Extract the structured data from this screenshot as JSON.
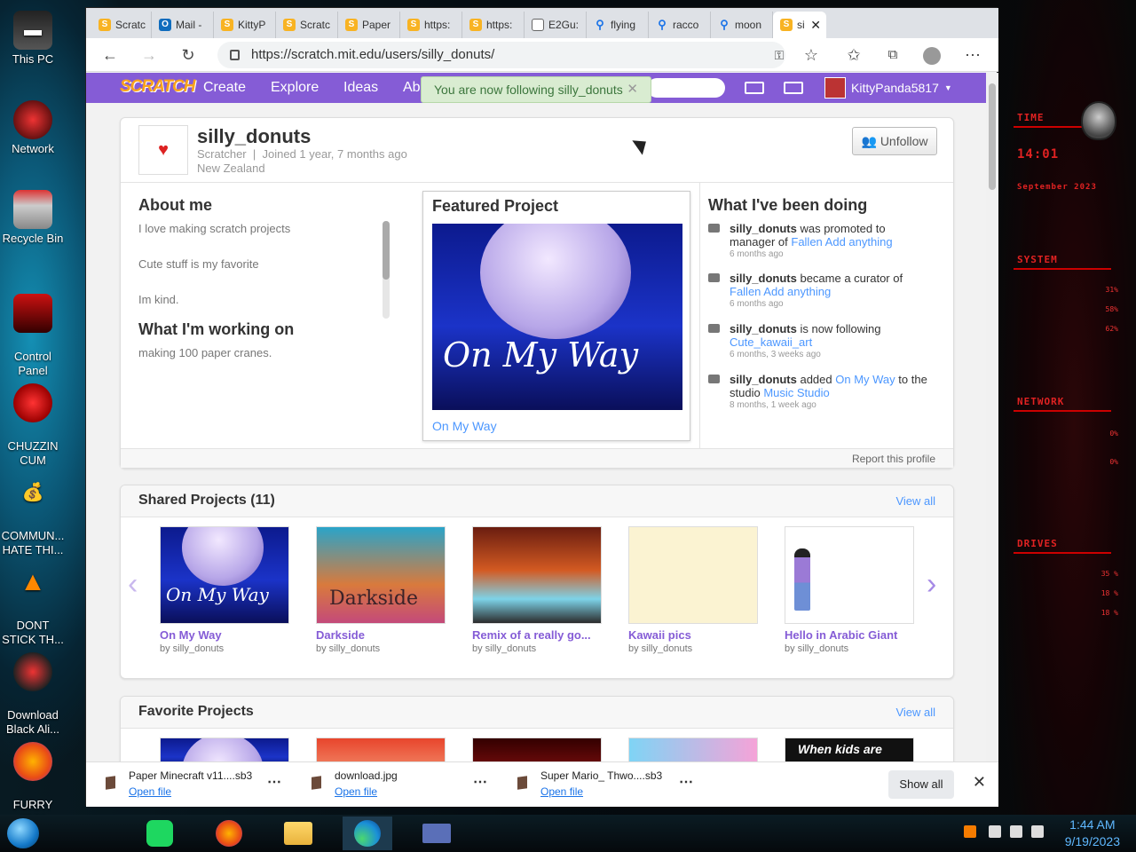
{
  "desktop": {
    "icons": [
      {
        "label": "This PC",
        "icon": "monitor-icon"
      },
      {
        "label": "Network",
        "icon": "network-icon"
      },
      {
        "label": "Recycle Bin",
        "icon": "recycle-bin-icon"
      },
      {
        "label": "Control\nPanel",
        "icon": "control-panel-icon"
      },
      {
        "label": "CHUZZIN\nCUM",
        "icon": "red-creature-icon"
      },
      {
        "label": "COMMUN...\nHATE THI...",
        "icon": "money-bag-icon"
      },
      {
        "label": "DONT\nSTICK TH...",
        "icon": "traffic-cone-icon"
      },
      {
        "label": "Download\nBlack Ali...",
        "icon": "alien-disc-icon"
      },
      {
        "label": "FURRY\nFUX",
        "icon": "firefox-icon"
      }
    ],
    "widget": {
      "labels": [
        "TIME",
        "14:01",
        "September 2023",
        "SYSTEM",
        "NETWORK",
        "DRIVES"
      ],
      "percents": [
        "31%",
        "58%",
        "62%",
        "0%",
        "0%",
        "35 %",
        "18 %",
        "18 %"
      ]
    }
  },
  "browser": {
    "tabs": [
      {
        "label": "Scratc",
        "icon": "scratch-icon"
      },
      {
        "label": "Mail -",
        "icon": "outlook-icon"
      },
      {
        "label": "KittyP",
        "icon": "scratch-icon"
      },
      {
        "label": "Scratc",
        "icon": "scratch-icon"
      },
      {
        "label": "Paper",
        "icon": "scratch-icon"
      },
      {
        "label": "https:",
        "icon": "scratch-icon"
      },
      {
        "label": "https:",
        "icon": "scratch-icon"
      },
      {
        "label": "E2Gu:",
        "icon": "document-icon"
      },
      {
        "label": "flying",
        "icon": "search-icon"
      },
      {
        "label": "racco",
        "icon": "search-icon"
      },
      {
        "label": "moon",
        "icon": "search-icon"
      },
      {
        "label": "si",
        "icon": "scratch-icon",
        "active": true
      }
    ],
    "url": "https://scratch.mit.edu/users/silly_donuts/"
  },
  "scratch": {
    "logo": "SCRATCH",
    "nav": [
      "Create",
      "Explore",
      "Ideas",
      "Ab"
    ],
    "toast": "You are now following silly_donuts",
    "account_name": "KittyPanda5817",
    "profile": {
      "username": "silly_donuts",
      "role": "Scratcher",
      "joined": "Joined 1 year, 7 months ago",
      "location": "New Zealand",
      "unfollow_label": "Unfollow"
    },
    "about": {
      "title": "About me",
      "lines": [
        "I love making scratch projects",
        "Cute stuff is my favorite",
        "Im kind."
      ],
      "working_title": "What I'm working on",
      "working_text": "making 100 paper cranes."
    },
    "featured": {
      "title": "Featured Project",
      "image_text": "On My Way",
      "caption": "On My Way"
    },
    "activity": {
      "title": "What I've been doing",
      "items": [
        {
          "user": "silly_donuts",
          "text": " was promoted to manager of ",
          "link": "Fallen Add anything",
          "tail": "",
          "ago": "6 months ago"
        },
        {
          "user": "silly_donuts",
          "text": " became a curator of ",
          "link": "Fallen Add anything",
          "tail": "",
          "ago": "6 months ago"
        },
        {
          "user": "silly_donuts",
          "text": " is now following ",
          "link": "Cute_kawaii_art",
          "tail": "",
          "ago": "6 months, 3 weeks ago"
        },
        {
          "user": "silly_donuts",
          "text": " added ",
          "link": "On My Way",
          "tail": " to the studio ",
          "link2": "Music Studio",
          "ago": "8 months, 1 week ago"
        }
      ],
      "report": "Report this profile"
    },
    "shared": {
      "title": "Shared Projects (11)",
      "view_all": "View all",
      "projects": [
        {
          "title": "On My Way",
          "by": "by silly_donuts"
        },
        {
          "title": "Darkside",
          "by": "by silly_donuts"
        },
        {
          "title": "Remix of a really go...",
          "by": "by silly_donuts"
        },
        {
          "title": "Kawaii pics",
          "by": "by silly_donuts"
        },
        {
          "title": "Hello in Arabic Giant",
          "by": "by silly_donuts"
        }
      ]
    },
    "favorites": {
      "title": "Favorite Projects",
      "view_all": "View all",
      "thumb_text": "When kids are"
    }
  },
  "downloads": {
    "items": [
      {
        "name": "Paper Minecraft v11....sb3",
        "action": "Open file"
      },
      {
        "name": "download.jpg",
        "action": "Open file"
      },
      {
        "name": "Super Mario_ Thwo....sb3",
        "action": "Open file"
      }
    ],
    "show_all": "Show all"
  },
  "taskbar": {
    "time": "1:44 AM",
    "date": "9/19/2023",
    "apps": [
      "spotify-icon",
      "firefox-icon",
      "file-explorer-icon",
      "edge-icon",
      "window-app-icon"
    ]
  }
}
